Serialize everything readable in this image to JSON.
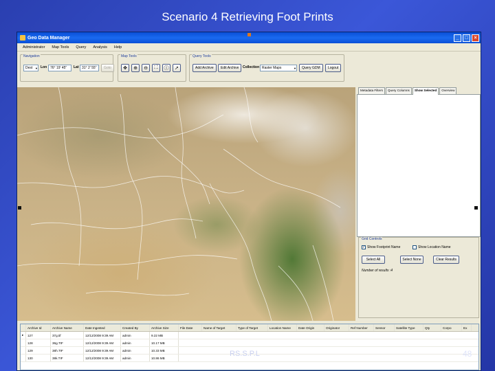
{
  "slide": {
    "title": "Scenario 4 Retrieving Foot Prints",
    "footer_left": "RS.S.P.L",
    "page_number": "48"
  },
  "window": {
    "title": "Geo Data Manager",
    "menu": [
      "Administrator",
      "Map Tools",
      "Query",
      "Analysis",
      "Help"
    ]
  },
  "navigation": {
    "group_label": "Navigation",
    "dropdown_value": "Dest",
    "lon_label": "Lon",
    "lon_value": "76° 19' 45\"",
    "lat_label": "Lat",
    "lat_value": "31° 2' 55\"",
    "go_button": "Goto"
  },
  "map_tools": {
    "group_label": "Map Tools",
    "icons": [
      "pan-icon",
      "zoom-in-icon",
      "zoom-out-icon",
      "full-extent-icon",
      "identify-icon",
      "select-icon"
    ]
  },
  "query_tools": {
    "group_label": "Query Tools",
    "add_archive": "Add Archive",
    "edit_archive": "Edit Archive",
    "collection_label": "Collection",
    "collection_value": "Raster Maps",
    "query_button": "Query GDM",
    "logout_button": "Logout"
  },
  "right_panel": {
    "tabs": [
      "Metadata Filters",
      "Query Columns",
      "Show Selected",
      "Overview"
    ],
    "active_tab": "Show Selected",
    "grid_controls_label": "Grid Controls",
    "show_footprint_label": "Show Footprint Name",
    "show_footprint_checked": true,
    "show_location_label": "Show Location Name",
    "show_location_checked": false,
    "select_all": "Select All",
    "select_none": "Select None",
    "clear_results": "Clear Results",
    "results_text": "Number of results :4"
  },
  "results_table": {
    "columns": [
      "Archive Id",
      "Archive Name",
      "Date Ingested",
      "Created By",
      "Archive Size",
      "File Date",
      "Name of Target",
      "Type of Target",
      "Location Name",
      "Date Origin",
      "Originator",
      "Ref Number",
      "Sensor",
      "Satellite Type",
      "Qty",
      "Corpo",
      "Ex"
    ],
    "rows": [
      [
        "127",
        "37g.tif",
        "12/12/2008 9:39 AM",
        "admin",
        "9.22 MB"
      ],
      [
        "128",
        "36g.TIF",
        "12/12/2008 9:39 AM",
        "admin",
        "10.17 MB"
      ],
      [
        "129",
        "38h.TIF",
        "12/12/2008 9:39 AM",
        "admin",
        "10.33 MB"
      ],
      [
        "130",
        "38k.TIF",
        "12/12/2008 9:39 AM",
        "admin",
        "10.86 MB"
      ]
    ]
  }
}
